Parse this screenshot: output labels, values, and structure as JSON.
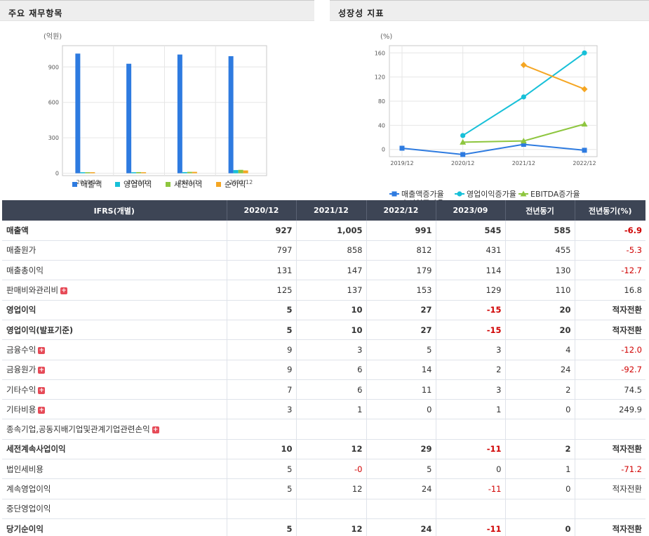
{
  "left_panel": {
    "title": "주요 재무항목",
    "chart_data": {
      "type": "bar",
      "unit_label": "(억원)",
      "categories": [
        "2019/12",
        "2020/12",
        "2021/12",
        "2022/12"
      ],
      "ylim": [
        -20,
        1080
      ],
      "yticks": [
        0,
        300,
        600,
        900
      ],
      "series": [
        {
          "name": "매출액",
          "color": "#2e7be0",
          "values": [
            1013,
            927,
            1005,
            991
          ]
        },
        {
          "name": "영업이익",
          "color": "#17c0d8",
          "values": [
            8,
            5,
            10,
            27
          ]
        },
        {
          "name": "세전이익",
          "color": "#8ec63f",
          "values": [
            4,
            10,
            12,
            29
          ]
        },
        {
          "name": "순이익",
          "color": "#f5a623",
          "values": [
            3,
            5,
            12,
            24
          ]
        }
      ],
      "grid": true,
      "legend_position": "bottom"
    }
  },
  "right_panel": {
    "title": "성장성 지표",
    "chart_data": {
      "type": "line",
      "unit_label": "(%)",
      "categories": [
        "2019/12",
        "2020/12",
        "2021/12",
        "2022/12"
      ],
      "ylim": [
        -12,
        172
      ],
      "yticks": [
        0,
        40,
        80,
        120,
        160
      ],
      "series": [
        {
          "name": "매출액증가율",
          "color": "#2e7be0",
          "marker": "square",
          "values": [
            2,
            -8.5,
            8.4,
            -1.4
          ]
        },
        {
          "name": "영업이익증가율",
          "color": "#17c0d8",
          "marker": "circle",
          "values": [
            null,
            23,
            87,
            160
          ]
        },
        {
          "name": "EBITDA증가율",
          "color": "#8ec63f",
          "marker": "triangle",
          "values": [
            null,
            12,
            14,
            42
          ]
        },
        {
          "name": "순이익증가율",
          "color": "#f5a623",
          "marker": "diamond",
          "values": [
            null,
            null,
            140,
            100
          ]
        }
      ],
      "grid": true,
      "legend_position": "bottom"
    }
  },
  "table": {
    "columns": [
      "IFRS(개별)",
      "2020/12",
      "2021/12",
      "2022/12",
      "2023/09",
      "전년동기",
      "전년동기(%)"
    ],
    "rows": [
      {
        "label": "매출액",
        "bold": true,
        "major": false,
        "expand": false,
        "values": [
          "927",
          "1,005",
          "991",
          "545",
          "585",
          "-6.9"
        ]
      },
      {
        "label": "매출원가",
        "bold": false,
        "major": false,
        "expand": false,
        "values": [
          "797",
          "858",
          "812",
          "431",
          "455",
          "-5.3"
        ]
      },
      {
        "label": "매출총이익",
        "bold": false,
        "major": false,
        "expand": false,
        "values": [
          "131",
          "147",
          "179",
          "114",
          "130",
          "-12.7"
        ]
      },
      {
        "label": "판매비와관리비",
        "bold": false,
        "major": false,
        "expand": true,
        "values": [
          "125",
          "137",
          "153",
          "129",
          "110",
          "16.8"
        ]
      },
      {
        "label": "영업이익",
        "bold": true,
        "major": true,
        "expand": false,
        "values": [
          "5",
          "10",
          "27",
          "-15",
          "20",
          "적자전환"
        ]
      },
      {
        "label": "영업이익(발표기준)",
        "bold": true,
        "major": false,
        "expand": false,
        "values": [
          "5",
          "10",
          "27",
          "-15",
          "20",
          "적자전환"
        ]
      },
      {
        "label": "금융수익",
        "bold": false,
        "major": true,
        "expand": true,
        "values": [
          "9",
          "3",
          "5",
          "3",
          "4",
          "-12.0"
        ]
      },
      {
        "label": "금융원가",
        "bold": false,
        "major": false,
        "expand": true,
        "values": [
          "9",
          "6",
          "14",
          "2",
          "24",
          "-92.7"
        ]
      },
      {
        "label": "기타수익",
        "bold": false,
        "major": false,
        "expand": true,
        "values": [
          "7",
          "6",
          "11",
          "3",
          "2",
          "74.5"
        ]
      },
      {
        "label": "기타비용",
        "bold": false,
        "major": false,
        "expand": true,
        "values": [
          "3",
          "1",
          "0",
          "1",
          "0",
          "249.9"
        ]
      },
      {
        "label": "종속기업,공동지배기업및관계기업관련손익",
        "bold": false,
        "major": false,
        "expand": true,
        "values": [
          "",
          "",
          "",
          "",
          "",
          ""
        ]
      },
      {
        "label": "세전계속사업이익",
        "bold": true,
        "major": true,
        "expand": false,
        "values": [
          "10",
          "12",
          "29",
          "-11",
          "2",
          "적자전환"
        ]
      },
      {
        "label": "법인세비용",
        "bold": false,
        "major": false,
        "expand": false,
        "values": [
          "5",
          "-0",
          "5",
          "0",
          "1",
          "-71.2"
        ]
      },
      {
        "label": "계속영업이익",
        "bold": false,
        "major": false,
        "expand": false,
        "values": [
          "5",
          "12",
          "24",
          "-11",
          "0",
          "적자전환"
        ]
      },
      {
        "label": "중단영업이익",
        "bold": false,
        "major": false,
        "expand": false,
        "values": [
          "",
          "",
          "",
          "",
          "",
          ""
        ]
      },
      {
        "label": "당기순이익",
        "bold": true,
        "major": true,
        "expand": false,
        "values": [
          "5",
          "12",
          "24",
          "-11",
          "0",
          "적자전환"
        ]
      }
    ]
  }
}
